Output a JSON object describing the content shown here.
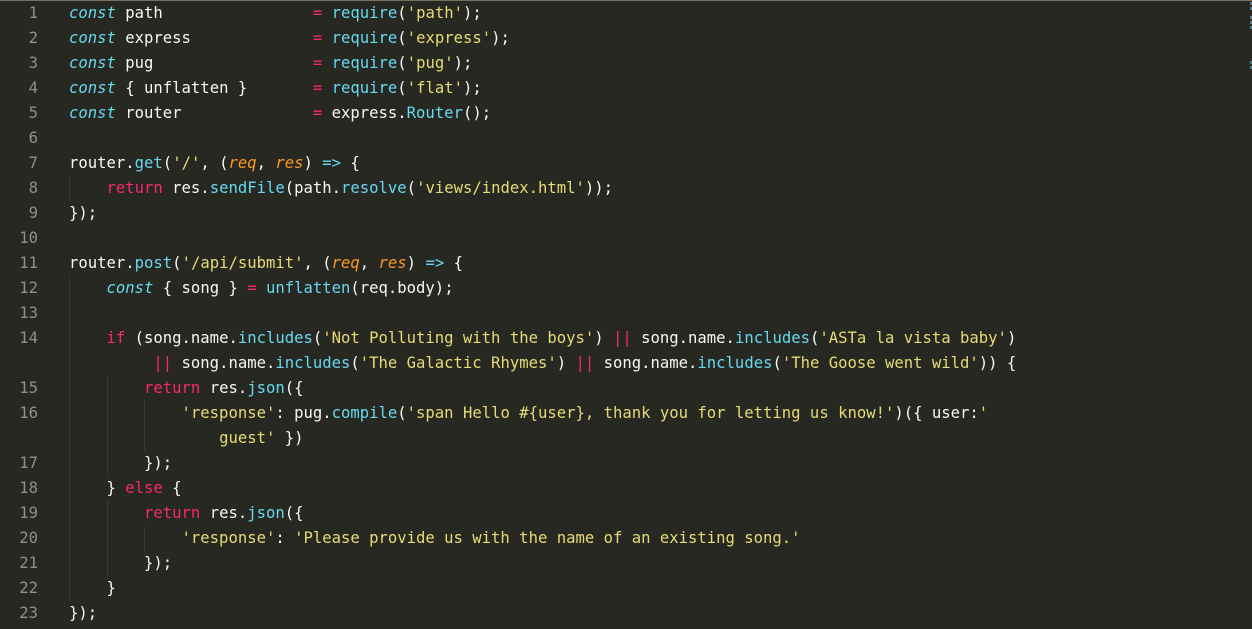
{
  "editor": {
    "theme_colors": {
      "background": "#272822",
      "foreground": "#f8f8f2",
      "keyword": "#f92672",
      "storage": "#66d9ef",
      "function": "#66d9ef",
      "string": "#e6db74",
      "parameter": "#fd971f",
      "line_number": "#8f908a"
    },
    "lines": [
      {
        "num": "1",
        "indent": 0,
        "tokens": [
          [
            "kw-storage",
            "const"
          ],
          [
            "plain",
            " path                "
          ],
          [
            "op",
            "="
          ],
          [
            "plain",
            " "
          ],
          [
            "fn",
            "require"
          ],
          [
            "plain",
            "("
          ],
          [
            "str",
            "'path'"
          ],
          [
            "plain",
            ");"
          ]
        ]
      },
      {
        "num": "2",
        "indent": 0,
        "tokens": [
          [
            "kw-storage",
            "const"
          ],
          [
            "plain",
            " express             "
          ],
          [
            "op",
            "="
          ],
          [
            "plain",
            " "
          ],
          [
            "fn",
            "require"
          ],
          [
            "plain",
            "("
          ],
          [
            "str",
            "'express'"
          ],
          [
            "plain",
            ");"
          ]
        ]
      },
      {
        "num": "3",
        "indent": 0,
        "tokens": [
          [
            "kw-storage",
            "const"
          ],
          [
            "plain",
            " pug                 "
          ],
          [
            "op",
            "="
          ],
          [
            "plain",
            " "
          ],
          [
            "fn",
            "require"
          ],
          [
            "plain",
            "("
          ],
          [
            "str",
            "'pug'"
          ],
          [
            "plain",
            ");"
          ]
        ]
      },
      {
        "num": "4",
        "indent": 0,
        "tokens": [
          [
            "kw-storage",
            "const"
          ],
          [
            "plain",
            " { unflatten }       "
          ],
          [
            "op",
            "="
          ],
          [
            "plain",
            " "
          ],
          [
            "fn",
            "require"
          ],
          [
            "plain",
            "("
          ],
          [
            "str",
            "'flat'"
          ],
          [
            "plain",
            ");"
          ]
        ]
      },
      {
        "num": "5",
        "indent": 0,
        "tokens": [
          [
            "kw-storage",
            "const"
          ],
          [
            "plain",
            " router              "
          ],
          [
            "op",
            "="
          ],
          [
            "plain",
            " express."
          ],
          [
            "fn",
            "Router"
          ],
          [
            "plain",
            "();"
          ]
        ]
      },
      {
        "num": "6",
        "indent": 0,
        "tokens": []
      },
      {
        "num": "7",
        "indent": 0,
        "tokens": [
          [
            "plain",
            "router."
          ],
          [
            "fn",
            "get"
          ],
          [
            "plain",
            "("
          ],
          [
            "str",
            "'/'"
          ],
          [
            "plain",
            ", ("
          ],
          [
            "param",
            "req"
          ],
          [
            "plain",
            ", "
          ],
          [
            "param",
            "res"
          ],
          [
            "plain",
            ") "
          ],
          [
            "fn",
            "=>"
          ],
          [
            "plain",
            " {"
          ]
        ]
      },
      {
        "num": "8",
        "indent": 1,
        "tokens": [
          [
            "plain",
            "    "
          ],
          [
            "kw",
            "return"
          ],
          [
            "plain",
            " res."
          ],
          [
            "fn",
            "sendFile"
          ],
          [
            "plain",
            "(path."
          ],
          [
            "fn",
            "resolve"
          ],
          [
            "plain",
            "("
          ],
          [
            "str",
            "'views/index.html'"
          ],
          [
            "plain",
            "));"
          ]
        ]
      },
      {
        "num": "9",
        "indent": 0,
        "tokens": [
          [
            "plain",
            "});"
          ]
        ]
      },
      {
        "num": "10",
        "indent": 0,
        "tokens": []
      },
      {
        "num": "11",
        "indent": 0,
        "tokens": [
          [
            "plain",
            "router."
          ],
          [
            "fn",
            "post"
          ],
          [
            "plain",
            "("
          ],
          [
            "str",
            "'/api/submit'"
          ],
          [
            "plain",
            ", ("
          ],
          [
            "param",
            "req"
          ],
          [
            "plain",
            ", "
          ],
          [
            "param",
            "res"
          ],
          [
            "plain",
            ") "
          ],
          [
            "fn",
            "=>"
          ],
          [
            "plain",
            " {"
          ]
        ]
      },
      {
        "num": "12",
        "indent": 1,
        "tokens": [
          [
            "plain",
            "    "
          ],
          [
            "kw-storage",
            "const"
          ],
          [
            "plain",
            " { song } "
          ],
          [
            "op",
            "="
          ],
          [
            "plain",
            " "
          ],
          [
            "fn",
            "unflatten"
          ],
          [
            "plain",
            "(req.body);"
          ]
        ]
      },
      {
        "num": "13",
        "indent": 1,
        "tokens": []
      },
      {
        "num": "14",
        "indent": 1,
        "tokens": [
          [
            "plain",
            "    "
          ],
          [
            "kw",
            "if"
          ],
          [
            "plain",
            " (song.name."
          ],
          [
            "fn",
            "includes"
          ],
          [
            "plain",
            "("
          ],
          [
            "str",
            "'Not Polluting with the boys'"
          ],
          [
            "plain",
            ") "
          ],
          [
            "op",
            "||"
          ],
          [
            "plain",
            " song.name."
          ],
          [
            "fn",
            "includes"
          ],
          [
            "plain",
            "("
          ],
          [
            "str",
            "'ASTa la vista baby'"
          ],
          [
            "plain",
            ")"
          ]
        ]
      },
      {
        "num": "",
        "indent": 1,
        "tokens": [
          [
            "plain",
            "         "
          ],
          [
            "op",
            "||"
          ],
          [
            "plain",
            " song.name."
          ],
          [
            "fn",
            "includes"
          ],
          [
            "plain",
            "("
          ],
          [
            "str",
            "'The Galactic Rhymes'"
          ],
          [
            "plain",
            ") "
          ],
          [
            "op",
            "||"
          ],
          [
            "plain",
            " song.name."
          ],
          [
            "fn",
            "includes"
          ],
          [
            "plain",
            "("
          ],
          [
            "str",
            "'The Goose went wild'"
          ],
          [
            "plain",
            ")) {"
          ]
        ]
      },
      {
        "num": "15",
        "indent": 2,
        "tokens": [
          [
            "plain",
            "        "
          ],
          [
            "kw",
            "return"
          ],
          [
            "plain",
            " res."
          ],
          [
            "fn",
            "json"
          ],
          [
            "plain",
            "({"
          ]
        ]
      },
      {
        "num": "16",
        "indent": 3,
        "tokens": [
          [
            "plain",
            "            "
          ],
          [
            "str",
            "'response'"
          ],
          [
            "plain",
            ": pug."
          ],
          [
            "fn",
            "compile"
          ],
          [
            "plain",
            "("
          ],
          [
            "str",
            "'span Hello #{user}, thank you for letting us know!'"
          ],
          [
            "plain",
            ")({ user:"
          ],
          [
            "str",
            "'"
          ]
        ]
      },
      {
        "num": "",
        "indent": 3,
        "tokens": [
          [
            "plain",
            "                "
          ],
          [
            "str",
            "guest'"
          ],
          [
            "plain",
            " })"
          ]
        ]
      },
      {
        "num": "17",
        "indent": 2,
        "tokens": [
          [
            "plain",
            "        });"
          ]
        ]
      },
      {
        "num": "18",
        "indent": 1,
        "tokens": [
          [
            "plain",
            "    } "
          ],
          [
            "kw",
            "else"
          ],
          [
            "plain",
            " {"
          ]
        ]
      },
      {
        "num": "19",
        "indent": 2,
        "tokens": [
          [
            "plain",
            "        "
          ],
          [
            "kw",
            "return"
          ],
          [
            "plain",
            " res."
          ],
          [
            "fn",
            "json"
          ],
          [
            "plain",
            "({"
          ]
        ]
      },
      {
        "num": "20",
        "indent": 3,
        "tokens": [
          [
            "plain",
            "            "
          ],
          [
            "str",
            "'response'"
          ],
          [
            "plain",
            ": "
          ],
          [
            "str",
            "'Please provide us with the name of an existing song.'"
          ]
        ]
      },
      {
        "num": "21",
        "indent": 2,
        "tokens": [
          [
            "plain",
            "        });"
          ]
        ]
      },
      {
        "num": "22",
        "indent": 1,
        "tokens": [
          [
            "plain",
            "    }"
          ]
        ]
      },
      {
        "num": "23",
        "indent": 0,
        "tokens": [
          [
            "plain",
            "});"
          ]
        ]
      }
    ]
  }
}
